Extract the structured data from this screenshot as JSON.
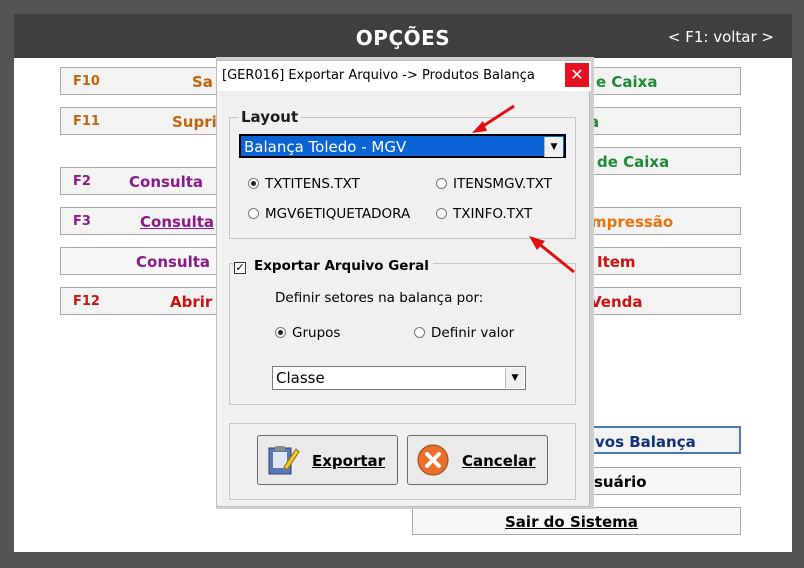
{
  "window": {
    "title": "OPÇÕES",
    "back_hint": "< F1: voltar >"
  },
  "colors": {
    "orange": "#c0650c",
    "purple": "#8a1a8a",
    "green": "#1f8a35",
    "red": "#cc1111",
    "navy": "#12317a"
  },
  "menu": {
    "f10": {
      "key": "F10",
      "label": "Sa"
    },
    "f11": {
      "key": "F11",
      "label": "Supri"
    },
    "f2": {
      "key": "F2",
      "label": "Consulta"
    },
    "f3": {
      "key": "F3",
      "label": "Consulta"
    },
    "consulta": {
      "label": "Consulta"
    },
    "f12": {
      "key": "F12",
      "label": "Abrir"
    },
    "r1": {
      "label": "e Caixa"
    },
    "r2": {
      "label": "a"
    },
    "r3": {
      "label": "de Caixa"
    },
    "r4": {
      "label": "mpressão"
    },
    "r5": {
      "label": "Item"
    },
    "r6": {
      "label": "Venda"
    },
    "r7": {
      "label": "vos Balança"
    },
    "r8": {
      "label": "suário"
    },
    "exit": {
      "label": "Sair do Sistema"
    }
  },
  "dialog": {
    "title": "[GER016]   Exportar Arquivo -> Produtos Balança",
    "close_glyph": "✕",
    "layout_group": "Layout",
    "layout_selected": "Balança Toledo - MGV",
    "radios": {
      "txtitens": "TXTITENS.TXT",
      "itensmgv": "ITENSMGV.TXT",
      "mgv6": "MGV6ETIQUETADORA",
      "txinfo": "TXINFO.TXT"
    },
    "export_general": "Exportar Arquivo Geral",
    "export_general_checked": true,
    "setores_label": "Definir setores na balança por:",
    "grupos": "Grupos",
    "definir_valor": "Definir valor",
    "setor_select": "Classe",
    "export_button": "Exportar",
    "cancel_button": "Cancelar",
    "check_glyph": "✓"
  }
}
